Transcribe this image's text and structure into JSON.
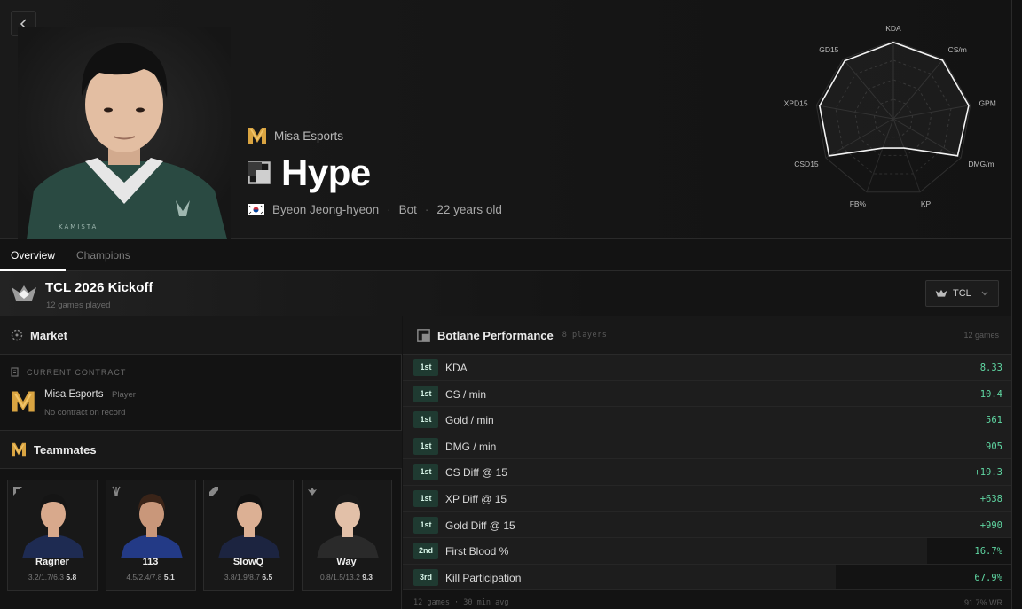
{
  "player": {
    "team": "Misa Esports",
    "name": "Hype",
    "flag": "KR",
    "real_name": "Byeon Jeong-hyeon",
    "role": "Bot",
    "age": "22 years old"
  },
  "radar": {
    "labels": [
      "KDA",
      "CS/m",
      "GPM",
      "DMG/m",
      "KP",
      "FB%",
      "CSD15",
      "XPD15",
      "GD15"
    ],
    "values": [
      0.98,
      0.98,
      0.98,
      0.95,
      0.4,
      0.4,
      0.95,
      0.96,
      0.97
    ]
  },
  "tabs": [
    {
      "label": "Overview",
      "active": true
    },
    {
      "label": "Champions",
      "active": false
    }
  ],
  "tournament": {
    "title": "TCL 2026 Kickoff",
    "games_played": "12 games played",
    "league": "TCL"
  },
  "market": {
    "title": "Market",
    "contract_label": "CURRENT CONTRACT",
    "team": "Misa Esports",
    "role": "Player",
    "note": "No contract on record"
  },
  "teammates": {
    "title": "Teammates",
    "items": [
      {
        "name": "Ragner",
        "stats": "3.2/1.7/6.3",
        "score": "5.8",
        "role_icon": "top-role-icon"
      },
      {
        "name": "113",
        "stats": "4.5/2.4/7.8",
        "score": "5.1",
        "role_icon": "jungle-role-icon"
      },
      {
        "name": "SlowQ",
        "stats": "3.8/1.9/8.7",
        "score": "6.5",
        "role_icon": "mid-role-icon"
      },
      {
        "name": "Way",
        "stats": "0.8/1.5/13.2",
        "score": "9.3",
        "role_icon": "support-role-icon"
      }
    ]
  },
  "performance": {
    "title": "Botlane Performance",
    "players": "8 players",
    "games": "12 games",
    "rows": [
      {
        "rank": "1st",
        "label": "KDA",
        "value": "8.33",
        "fill": 1.0
      },
      {
        "rank": "1st",
        "label": "CS / min",
        "value": "10.4",
        "fill": 1.0
      },
      {
        "rank": "1st",
        "label": "Gold / min",
        "value": "561",
        "fill": 1.0
      },
      {
        "rank": "1st",
        "label": "DMG / min",
        "value": "905",
        "fill": 1.0
      },
      {
        "rank": "1st",
        "label": "CS Diff @ 15",
        "value": "+19.3",
        "fill": 1.0
      },
      {
        "rank": "1st",
        "label": "XP Diff @ 15",
        "value": "+638",
        "fill": 1.0
      },
      {
        "rank": "1st",
        "label": "Gold Diff @ 15",
        "value": "+990",
        "fill": 1.0
      },
      {
        "rank": "2nd",
        "label": "First Blood %",
        "value": "16.7%",
        "fill": 0.86
      },
      {
        "rank": "3rd",
        "label": "Kill Participation",
        "value": "67.9%",
        "fill": 0.71
      }
    ],
    "footer": "12 games · 30 min avg",
    "winrate": "91.7% WR"
  },
  "colors": {
    "accent_green": "#5fd6a2",
    "badge_bg": "#1f3a31",
    "team_gold": "#d9a441"
  }
}
